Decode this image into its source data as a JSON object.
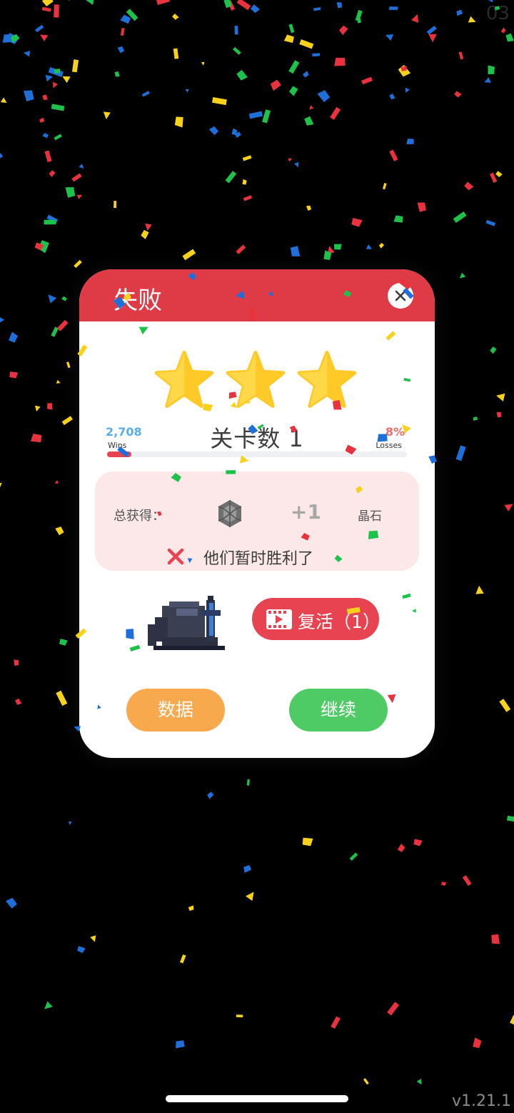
{
  "corner_number": "03",
  "version": "v1.21.1",
  "dialog": {
    "title": "失败",
    "close_icon": "close-icon",
    "stars_count": 3,
    "wins_value": "2,708",
    "wins_label": "Wins",
    "losses_value": "8%",
    "losses_label": "Losses",
    "level_text": "关卡数  1",
    "progress_fraction": 0.08,
    "reward": {
      "label": "总获得：",
      "icon": "gem-icon",
      "amount": "+1",
      "currency": "晶石"
    },
    "fail_icon": "x-icon",
    "fail_message": "他们暂时胜利了",
    "revive_icon": "video-icon",
    "revive_label": "复活（1）",
    "data_button": "数据",
    "continue_button": "继续"
  },
  "colors": {
    "header_red": "#de3b47",
    "wins_blue": "#58aee8",
    "losses_red": "#f06a6a",
    "data_orange": "#f8a94d",
    "continue_green": "#4ecb64",
    "star_yellow": "#ffc928"
  }
}
